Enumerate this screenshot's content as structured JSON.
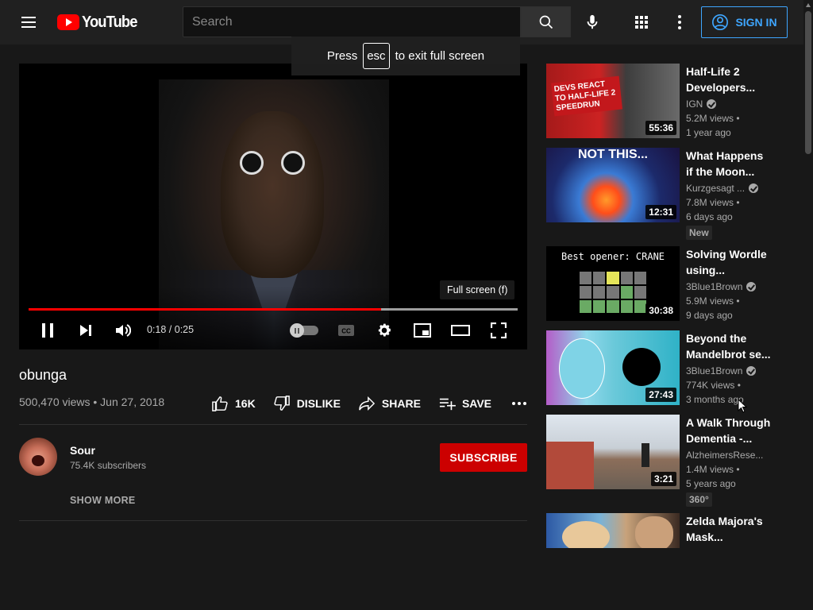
{
  "header": {
    "logo_text": "YouTube",
    "search_placeholder": "Search",
    "signin_label": "SIGN IN"
  },
  "toast": {
    "press": "Press",
    "key": "esc",
    "rest": "to exit full screen"
  },
  "player": {
    "tooltip": "Full screen (f)",
    "time": "0:18 / 0:25",
    "progress_fraction": 0.72
  },
  "video": {
    "title": "obunga",
    "views_date": "500,470 views • Jun 27, 2018",
    "like_count": "16K",
    "dislike_label": "DISLIKE",
    "share_label": "SHARE",
    "save_label": "SAVE"
  },
  "channel": {
    "name": "Sour",
    "subscribers": "75.4K subscribers",
    "subscribe_label": "SUBSCRIBE",
    "show_more": "SHOW MORE"
  },
  "recommendations": [
    {
      "title1": "Half-Life 2",
      "title2": "Developers...",
      "channel": "IGN",
      "verified": true,
      "views": "5.2M views •",
      "age": "1 year ago",
      "duration": "55:36",
      "badge": "",
      "thumb_text": "DEVS REACT TO HALF-LIFE 2 SPEEDRUN"
    },
    {
      "title1": "What Happens",
      "title2": "if the Moon...",
      "channel": "Kurzgesagt ...",
      "verified": true,
      "views": "7.8M views •",
      "age": "6 days ago",
      "duration": "12:31",
      "badge": "New",
      "thumb_text": "NOT THIS..."
    },
    {
      "title1": "Solving Wordle",
      "title2": "using...",
      "channel": "3Blue1Brown",
      "verified": true,
      "views": "5.9M views •",
      "age": "9 days ago",
      "duration": "30:38",
      "badge": "",
      "thumb_text": "Best opener: CRANE"
    },
    {
      "title1": "Beyond the",
      "title2": "Mandelbrot se...",
      "channel": "3Blue1Brown",
      "verified": true,
      "views": "774K views •",
      "age": "3 months ago",
      "duration": "27:43",
      "badge": ""
    },
    {
      "title1": "A Walk Through",
      "title2": "Dementia -...",
      "channel": "AlzheimersRese...",
      "verified": false,
      "views": "1.4M views •",
      "age": "5 years ago",
      "duration": "3:21",
      "badge": "360°"
    },
    {
      "title1": "Zelda Majora's",
      "title2": "Mask...",
      "channel": "",
      "verified": false,
      "views": "",
      "age": "",
      "duration": "",
      "badge": ""
    }
  ]
}
